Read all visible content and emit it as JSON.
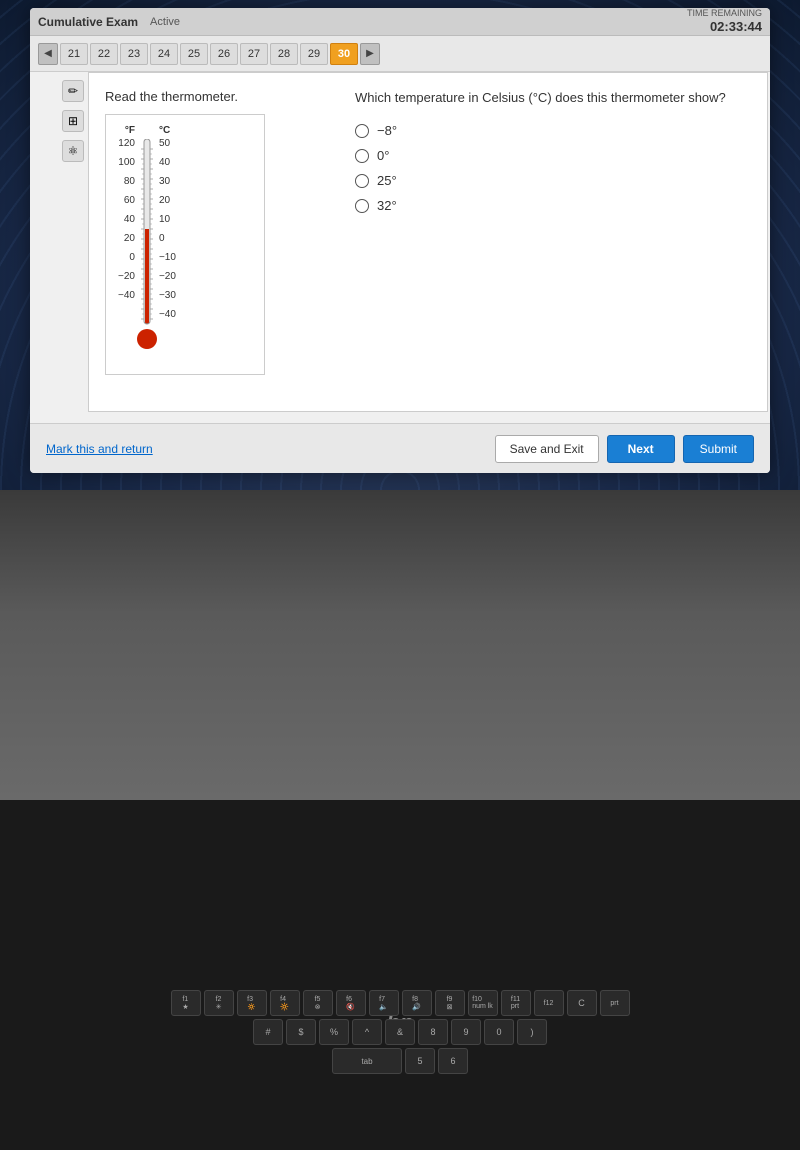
{
  "header": {
    "title": "Cumulative Exam",
    "status": "Active",
    "time_label": "TIME REMAINING",
    "time_value": "02:33:44"
  },
  "nav": {
    "prev_arrow": "◀",
    "next_arrow": "▶",
    "numbers": [
      "21",
      "22",
      "23",
      "24",
      "25",
      "26",
      "27",
      "28",
      "29",
      "30"
    ],
    "active_num": "30"
  },
  "left_icons": {
    "pencil": "✏",
    "grid": "⊞",
    "atom": "⚛"
  },
  "question": {
    "instruction": "Read the thermometer.",
    "text": "Which temperature in Celsius (°C) does this thermometer show?",
    "options": [
      {
        "label": "−8°",
        "selected": false
      },
      {
        "label": "0°",
        "selected": false
      },
      {
        "label": "25°",
        "selected": false
      },
      {
        "label": "32°",
        "selected": false
      }
    ]
  },
  "thermometer": {
    "f_label": "°F",
    "c_label": "°C",
    "f_scale": [
      "120",
      "100",
      "80",
      "60",
      "40",
      "20",
      "0",
      "−20",
      "−40"
    ],
    "c_scale": [
      "50",
      "40",
      "30",
      "20",
      "10",
      "0",
      "−10",
      "−20",
      "−30",
      "−40"
    ]
  },
  "bottom": {
    "mark_return": "Mark this and return",
    "save_exit": "Save and Exit",
    "next": "Next",
    "submit": "Submit"
  },
  "hp_logo": "hp"
}
